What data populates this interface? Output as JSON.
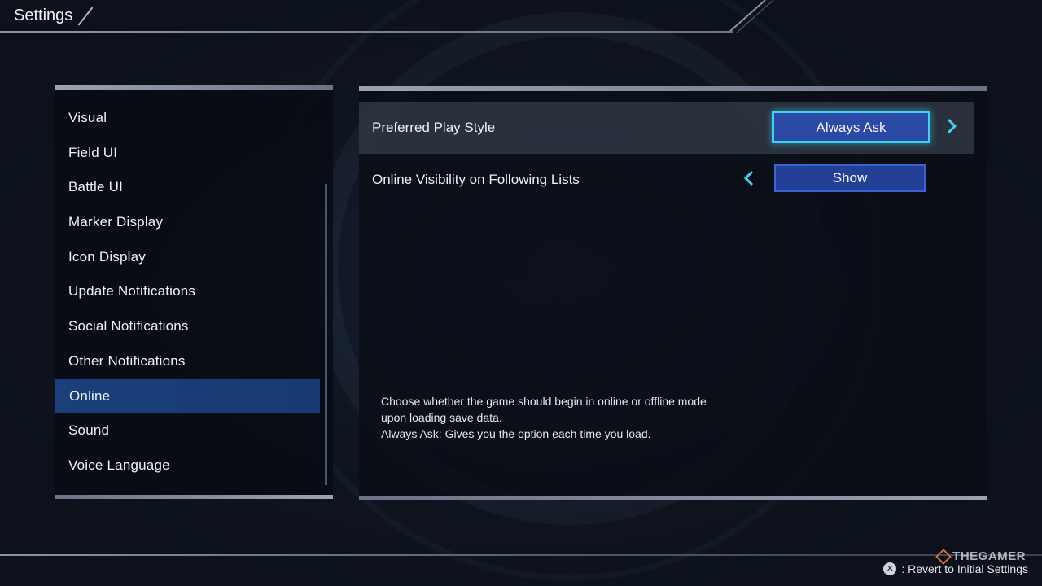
{
  "header": {
    "title": "Settings"
  },
  "sidebar": {
    "items": [
      {
        "label": "Visual"
      },
      {
        "label": "Field UI"
      },
      {
        "label": "Battle UI"
      },
      {
        "label": "Marker Display"
      },
      {
        "label": "Icon Display"
      },
      {
        "label": "Update Notifications"
      },
      {
        "label": "Social Notifications"
      },
      {
        "label": "Other Notifications"
      },
      {
        "label": "Online"
      },
      {
        "label": "Sound"
      },
      {
        "label": "Voice Language"
      }
    ],
    "selected": "Online"
  },
  "options": [
    {
      "label": "Preferred Play Style",
      "value": "Always Ask",
      "focused": true
    },
    {
      "label": "Online Visibility on Following Lists",
      "value": "Show",
      "focused": false
    }
  ],
  "description": {
    "lines": [
      "Choose whether the game should begin in online or offline mode",
      "upon loading save data.",
      "Always Ask: Gives you the option each time you load."
    ]
  },
  "footer": {
    "button_glyph": "✕",
    "hint": ": Revert to Initial Settings"
  },
  "watermark": {
    "text": "THEGAMER"
  },
  "colors": {
    "accent_cyan": "#3fd2f2",
    "selection_blue": "#1a3f7a",
    "value_box": "#243f96"
  }
}
